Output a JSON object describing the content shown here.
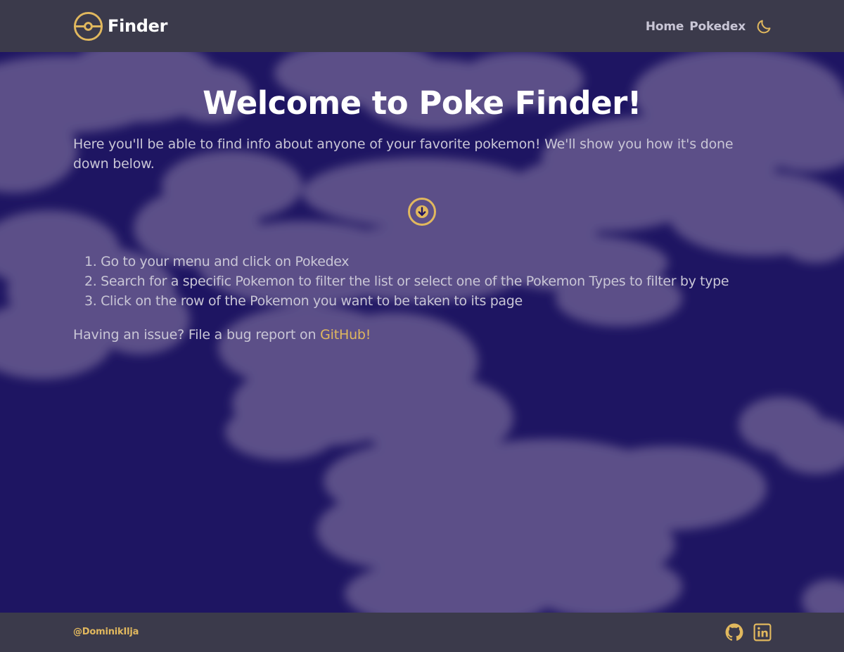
{
  "app": {
    "brand_name": "Finder",
    "brand_icon": "pokeball-icon"
  },
  "nav": {
    "home_label": "Home",
    "pokedex_label": "Pokedex",
    "theme_icon": "moon-icon"
  },
  "main": {
    "title": "Welcome to Poke Finder!",
    "intro": "Here you'll be able to find info about anyone of your favorite pokemon! We'll show you how it's done down below.",
    "scroll_icon": "arrow-down-circle-icon",
    "steps": [
      {
        "num": "1.",
        "text": "Go to your menu and click on Pokedex"
      },
      {
        "num": "2.",
        "text": "Search for a specific Pokemon to filter the list or select one of the Pokemon Types to filter by type"
      },
      {
        "num": "3.",
        "text": "Click on the row of the Pokemon you want to be taken to its page"
      }
    ],
    "bug_text": "Having an issue? File a bug report on ",
    "bug_link": "GitHub!"
  },
  "footer": {
    "handle": "@DominikIlja",
    "social_icons": [
      "github-icon",
      "linkedin-icon"
    ]
  },
  "colors": {
    "navbar_bg": "#3b3a4b",
    "sky_bg": "#1e1562",
    "cloud": "#5b5088",
    "accent": "#e1b85e",
    "text_muted": "#c9c6d6",
    "title": "#ffffff"
  }
}
